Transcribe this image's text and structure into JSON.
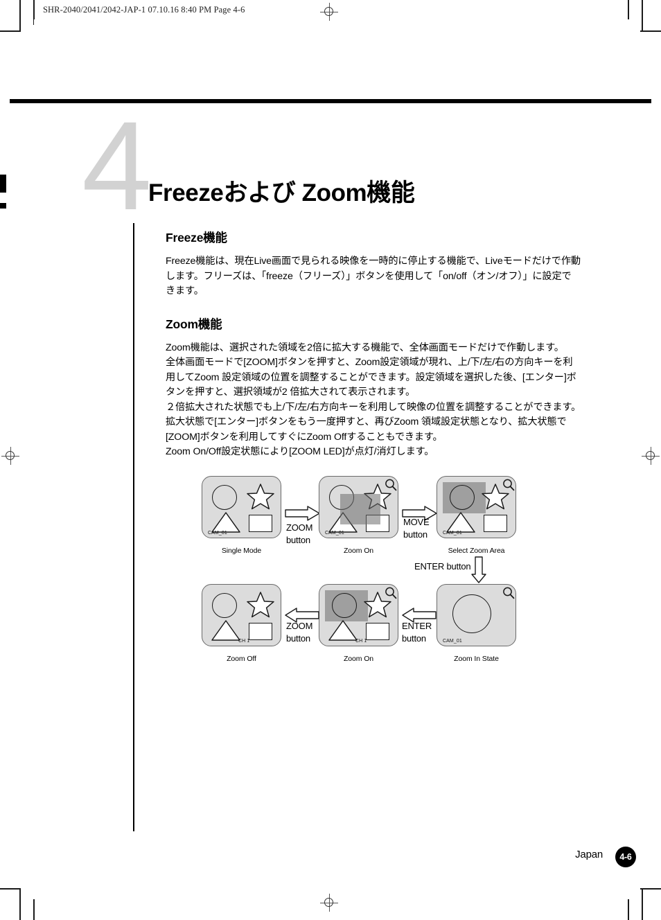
{
  "header": {
    "slug": "SHR-2040/2041/2042-JAP-1  07.10.16 8:40 PM  Page 4-6"
  },
  "chapter": {
    "number": "4",
    "title": "Freezeおよび Zoom機能"
  },
  "sections": [
    {
      "heading": "Freeze機能",
      "body": "Freeze機能は、現在Live画面で見られる映像を一時的に停止する機能で、Liveモードだけで作動\nします。フリーズは、「freeze（フリーズ）」ボタンを使用して「on/off（オン/オフ）」に設定で\nきます。"
    },
    {
      "heading": "Zoom機能",
      "body": "Zoom機能は、選択された領域を2倍に拡大する機能で、全体画面モードだけで作動します。\n全体画面モードで[ZOOM]ボタンを押すと、Zoom設定領域が現れ、上/下/左/右の方向キーを利\n用してZoom 設定領域の位置を調整することができます。設定領域を選択した後、[エンター]ボ\nタンを押すと、選択領域が2 倍拡大されて表示されます。\n２倍拡大された状態でも上/下/左/右方向キーを利用して映像の位置を調整することができます。\n拡大状態で[エンター]ボタンをもう一度押すと、再びZoom 領域設定状態となり、拡大状態で\n[ZOOM]ボタンを利用してすぐにZoom Offすることもできます。\nZoom On/Off設定状態により[ZOOM LED]が点灯/消灯します。"
    }
  ],
  "diagram": {
    "panels": [
      {
        "id": "single-mode",
        "caption": "Single Mode",
        "osd": "CAM_01",
        "magnifier": false,
        "zoombox": false,
        "zoomed": false
      },
      {
        "id": "zoom-on-top",
        "caption": "Zoom On",
        "osd": "CAM_01",
        "magnifier": true,
        "zoombox": true,
        "zoomed": false
      },
      {
        "id": "select-zoom-area",
        "caption": "Select Zoom Area",
        "osd": "CAM_01",
        "magnifier": true,
        "zoombox": true,
        "zoomed": false
      },
      {
        "id": "zoom-in-state",
        "caption": "Zoom In State",
        "osd": "CAM_01",
        "magnifier": true,
        "zoombox": false,
        "zoomed": true
      },
      {
        "id": "zoom-on-bottom",
        "caption": "Zoom On",
        "osd": "CH 1",
        "magnifier": true,
        "zoombox": true,
        "zoomed": false
      },
      {
        "id": "zoom-off",
        "caption": "Zoom Off",
        "osd": "CH 1",
        "magnifier": false,
        "zoombox": false,
        "zoomed": false
      }
    ],
    "transitions": [
      {
        "id": "zoom-button-top",
        "line1": "ZOOM",
        "line2": "button"
      },
      {
        "id": "move-button",
        "line1": "MOVE",
        "line2": "button"
      },
      {
        "id": "enter-button-vertical",
        "line1": "ENTER button",
        "line2": ""
      },
      {
        "id": "enter-button-left",
        "line1": "ENTER",
        "line2": "button"
      },
      {
        "id": "zoom-button-bottom",
        "line1": "ZOOM",
        "line2": "button"
      }
    ]
  },
  "footer": {
    "country": "Japan",
    "page_badge": "4-6"
  },
  "colors": {
    "panel_fill": "#dcdcdc",
    "panel_stroke": "#6a6a6a",
    "zoom_overlay": "#6e6e6e",
    "chapter_number": "#d2d2d2",
    "rule": "#000000"
  }
}
